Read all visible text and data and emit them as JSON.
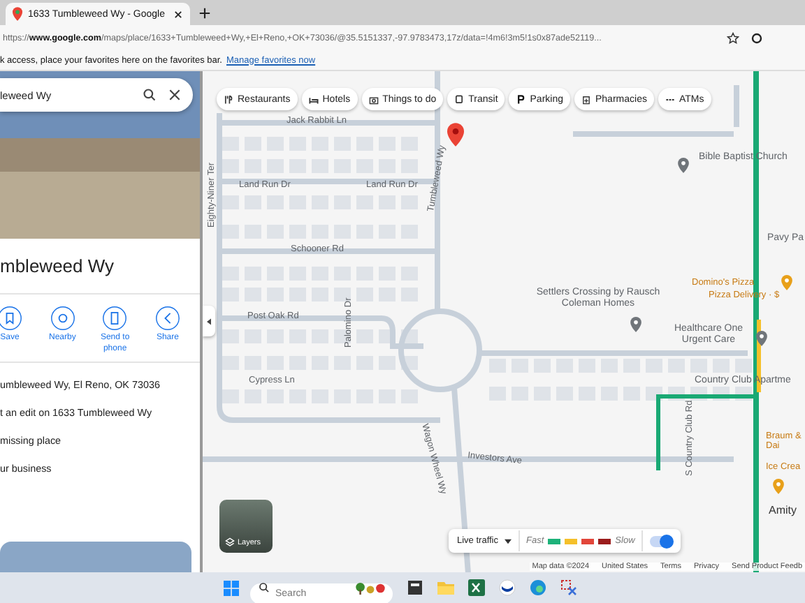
{
  "browser": {
    "tab_title": "1633 Tumbleweed Wy - Google",
    "url_prefix": "https://",
    "url_host": "www.google.com",
    "url_path": "/maps/place/1633+Tumbleweed+Wy,+El+Reno,+OK+73036/@35.5151337,-97.9783473,17z/data=!4m6!3m5!1s0x87ade52119...",
    "favorites_text": "k access, place your favorites here on the favorites bar.",
    "favorites_link": "Manage favorites now"
  },
  "panel": {
    "search_value": "leweed Wy",
    "title": "mbleweed Wy",
    "actions": [
      {
        "label": "Save",
        "kind": "save"
      },
      {
        "label": "Nearby",
        "kind": "nearby"
      },
      {
        "label": "Send to phone",
        "kind": "send"
      },
      {
        "label": "Share",
        "kind": "share"
      }
    ],
    "rows": [
      "umbleweed Wy, El Reno, OK 73036",
      "t an edit on 1633 Tumbleweed Wy",
      "missing place",
      "ur business"
    ]
  },
  "chips": [
    {
      "label": "Restaurants",
      "kind": "restaurant"
    },
    {
      "label": "Hotels",
      "kind": "hotel"
    },
    {
      "label": "Things to do",
      "kind": "camera"
    },
    {
      "label": "Transit",
      "kind": "transit"
    },
    {
      "label": "Parking",
      "kind": "parking"
    },
    {
      "label": "Pharmacies",
      "kind": "pharmacy"
    },
    {
      "label": "ATMs",
      "kind": "atm"
    }
  ],
  "map_labels": [
    {
      "text": "Jack Rabbit Ln",
      "kind": "street"
    },
    {
      "text": "Land Run Dr",
      "kind": "street"
    },
    {
      "text": "Land Run Dr",
      "kind": "street"
    },
    {
      "text": "Eighty-Niner Ter",
      "kind": "street"
    },
    {
      "text": "Tumbleweed Wy",
      "kind": "street"
    },
    {
      "text": "Schooner Rd",
      "kind": "street"
    },
    {
      "text": "Post Oak Rd",
      "kind": "street"
    },
    {
      "text": "Palomino Dr",
      "kind": "street"
    },
    {
      "text": "Cypress Ln",
      "kind": "street"
    },
    {
      "text": "Wagon Wheel Wy",
      "kind": "street"
    },
    {
      "text": "Investors Ave",
      "kind": "street"
    },
    {
      "text": "S Country Club Rd",
      "kind": "street"
    },
    {
      "text": "Bible Baptist Church",
      "kind": "place"
    },
    {
      "text": "Pavy Pa",
      "kind": "place"
    },
    {
      "text": "Settlers Crossing by Rausch Coleman Homes",
      "kind": "place"
    },
    {
      "text": "Domino's Pizza",
      "kind": "food"
    },
    {
      "text": "Pizza Delivery · $",
      "kind": "food"
    },
    {
      "text": "Healthcare One Urgent Care",
      "kind": "place"
    },
    {
      "text": "Country Club Apartme",
      "kind": "place"
    },
    {
      "text": "Braum & Dai",
      "kind": "food"
    },
    {
      "text": "Ice Crea",
      "kind": "food"
    },
    {
      "text": "Amity",
      "kind": "town"
    }
  ],
  "layers": {
    "label": "Layers"
  },
  "traffic": {
    "label": "Live traffic",
    "fast": "Fast",
    "slow": "Slow",
    "on": true,
    "legend": [
      {
        "color": "#1db27a"
      },
      {
        "color": "#f5c02a"
      },
      {
        "color": "#e2463a"
      },
      {
        "color": "#9b1c1c"
      }
    ]
  },
  "footer": [
    "Map data ©2024",
    "United States",
    "Terms",
    "Privacy",
    "Send Product Feedb"
  ],
  "taskbar": {
    "search_placeholder": "Search"
  }
}
